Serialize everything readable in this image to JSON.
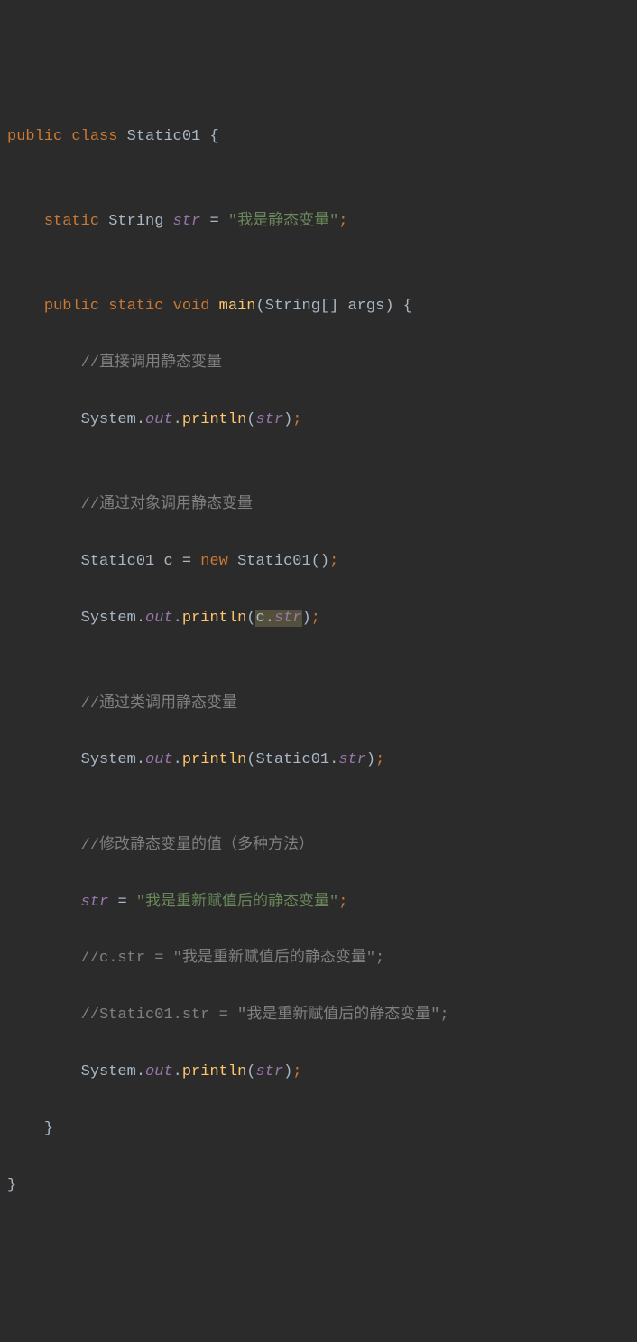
{
  "code": {
    "kw_public": "public",
    "kw_class": "class",
    "kw_static": "static",
    "kw_void": "void",
    "kw_new": "new",
    "cls_name": "Static01",
    "type_string": "String",
    "var_str": "str",
    "eq": "=",
    "semi": ";",
    "str_literal1": "\"我是静态变量\"",
    "brace_open": "{",
    "brace_close": "}",
    "mth_main": "main",
    "param_type": "String",
    "param_brackets": "[]",
    "param_name": "args",
    "paren_open": "(",
    "paren_close": ")",
    "cmt1": "//直接调用静态变量",
    "obj_system": "System",
    "dot": ".",
    "fld_out": "out",
    "mth_println": "println",
    "cmt2": "//通过对象调用静态变量",
    "var_c": "c",
    "ctor_parens": "()",
    "cmt3": "//通过类调用静态变量",
    "cmt4": "//修改静态变量的值（多种方法）",
    "str_literal2": "\"我是重新赋值后的静态变量\"",
    "cmt5": "//c.str = \"我是重新赋值后的静态变量\";",
    "cmt6": "//Static01.str = \"我是重新赋值后的静态变量\";"
  }
}
